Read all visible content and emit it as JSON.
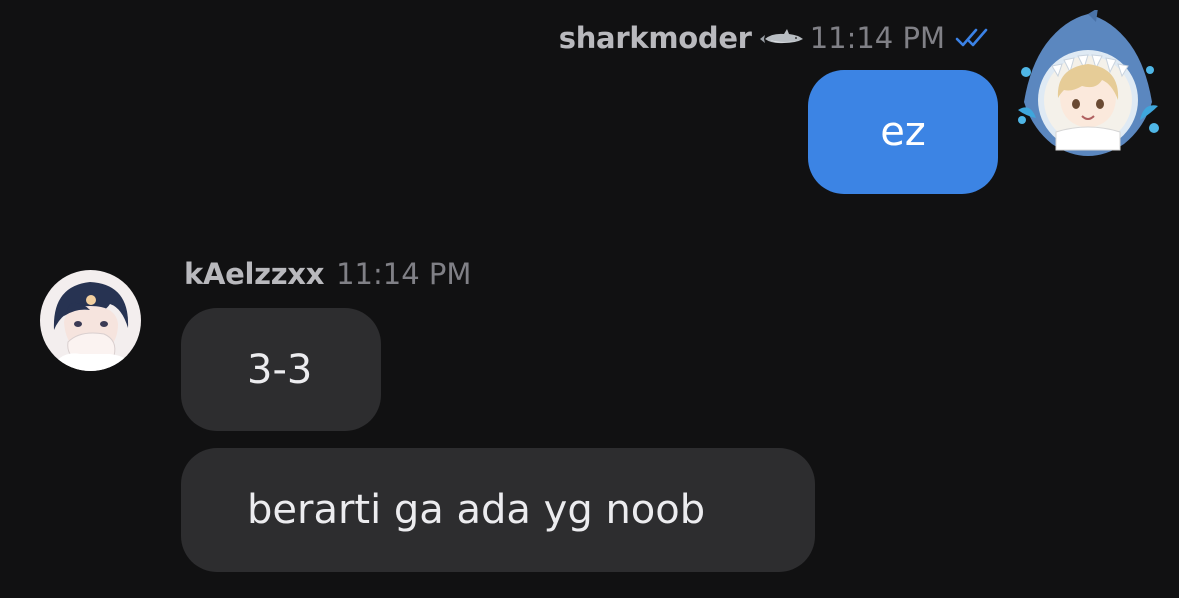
{
  "outgoing": {
    "sender": "sharkmoder",
    "time": "11:14 PM",
    "read_status_icon": "double-check-icon",
    "messages": [
      "ez"
    ]
  },
  "incoming": {
    "sender": "kAelzzxx",
    "time": "11:14 PM",
    "messages": [
      "3-3",
      "berarti ga ada yg noob"
    ]
  },
  "colors": {
    "background": "#111112",
    "outgoing_bubble": "#3c84e4",
    "incoming_bubble": "#2d2d2f",
    "check_blue": "#3b82e6"
  }
}
